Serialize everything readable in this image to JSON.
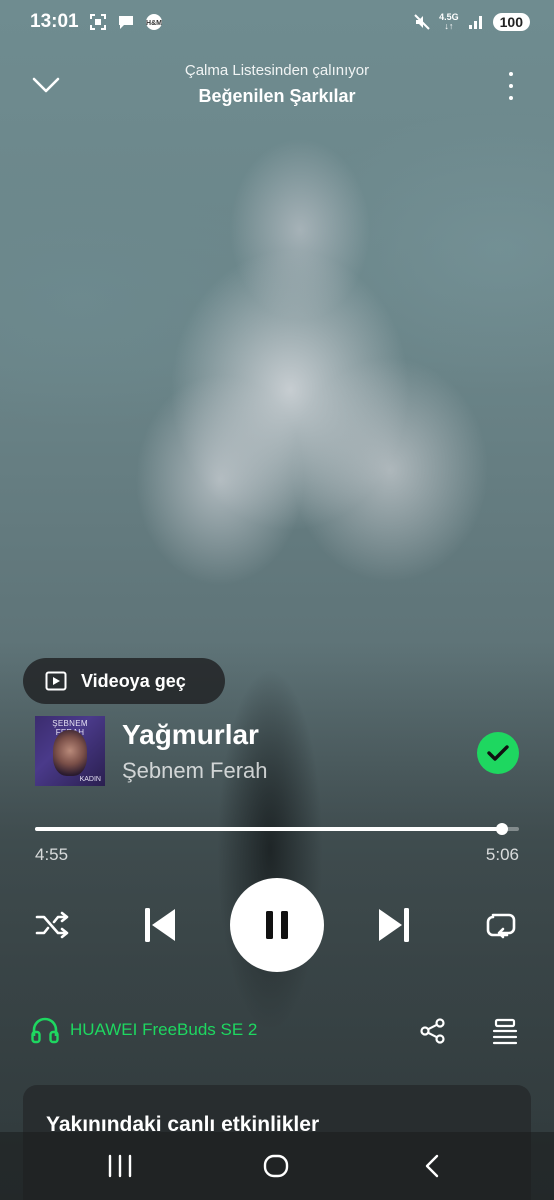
{
  "status_bar": {
    "time": "13:01",
    "network": "4.5G",
    "battery": "100"
  },
  "header": {
    "context_label": "Çalma Listesinden çalınıyor",
    "playlist_name": "Beğenilen Şarkılar"
  },
  "video_toggle": {
    "label": "Videoya geç"
  },
  "track": {
    "title": "Yağmurlar",
    "artist": "Şebnem Ferah",
    "cover_text_top": "ŞEBNEM FERAH",
    "cover_text_bottom": "KADIN",
    "liked": true
  },
  "playback": {
    "elapsed": "4:55",
    "total": "5:06",
    "progress_fraction": 0.964,
    "state": "playing"
  },
  "device": {
    "name": "HUAWEI FreeBuds SE 2"
  },
  "events_card": {
    "title": "Yakınındaki canlı etkinlikler"
  },
  "colors": {
    "accent_green": "#1ed760",
    "chip_bg": "#232628",
    "card_bg": "#282c2e"
  },
  "icons": [
    "chevron-down-icon",
    "more-vertical-icon",
    "video-icon",
    "check-icon",
    "shuffle-icon",
    "previous-icon",
    "pause-icon",
    "next-icon",
    "repeat-icon",
    "headphones-icon",
    "share-icon",
    "queue-icon"
  ]
}
